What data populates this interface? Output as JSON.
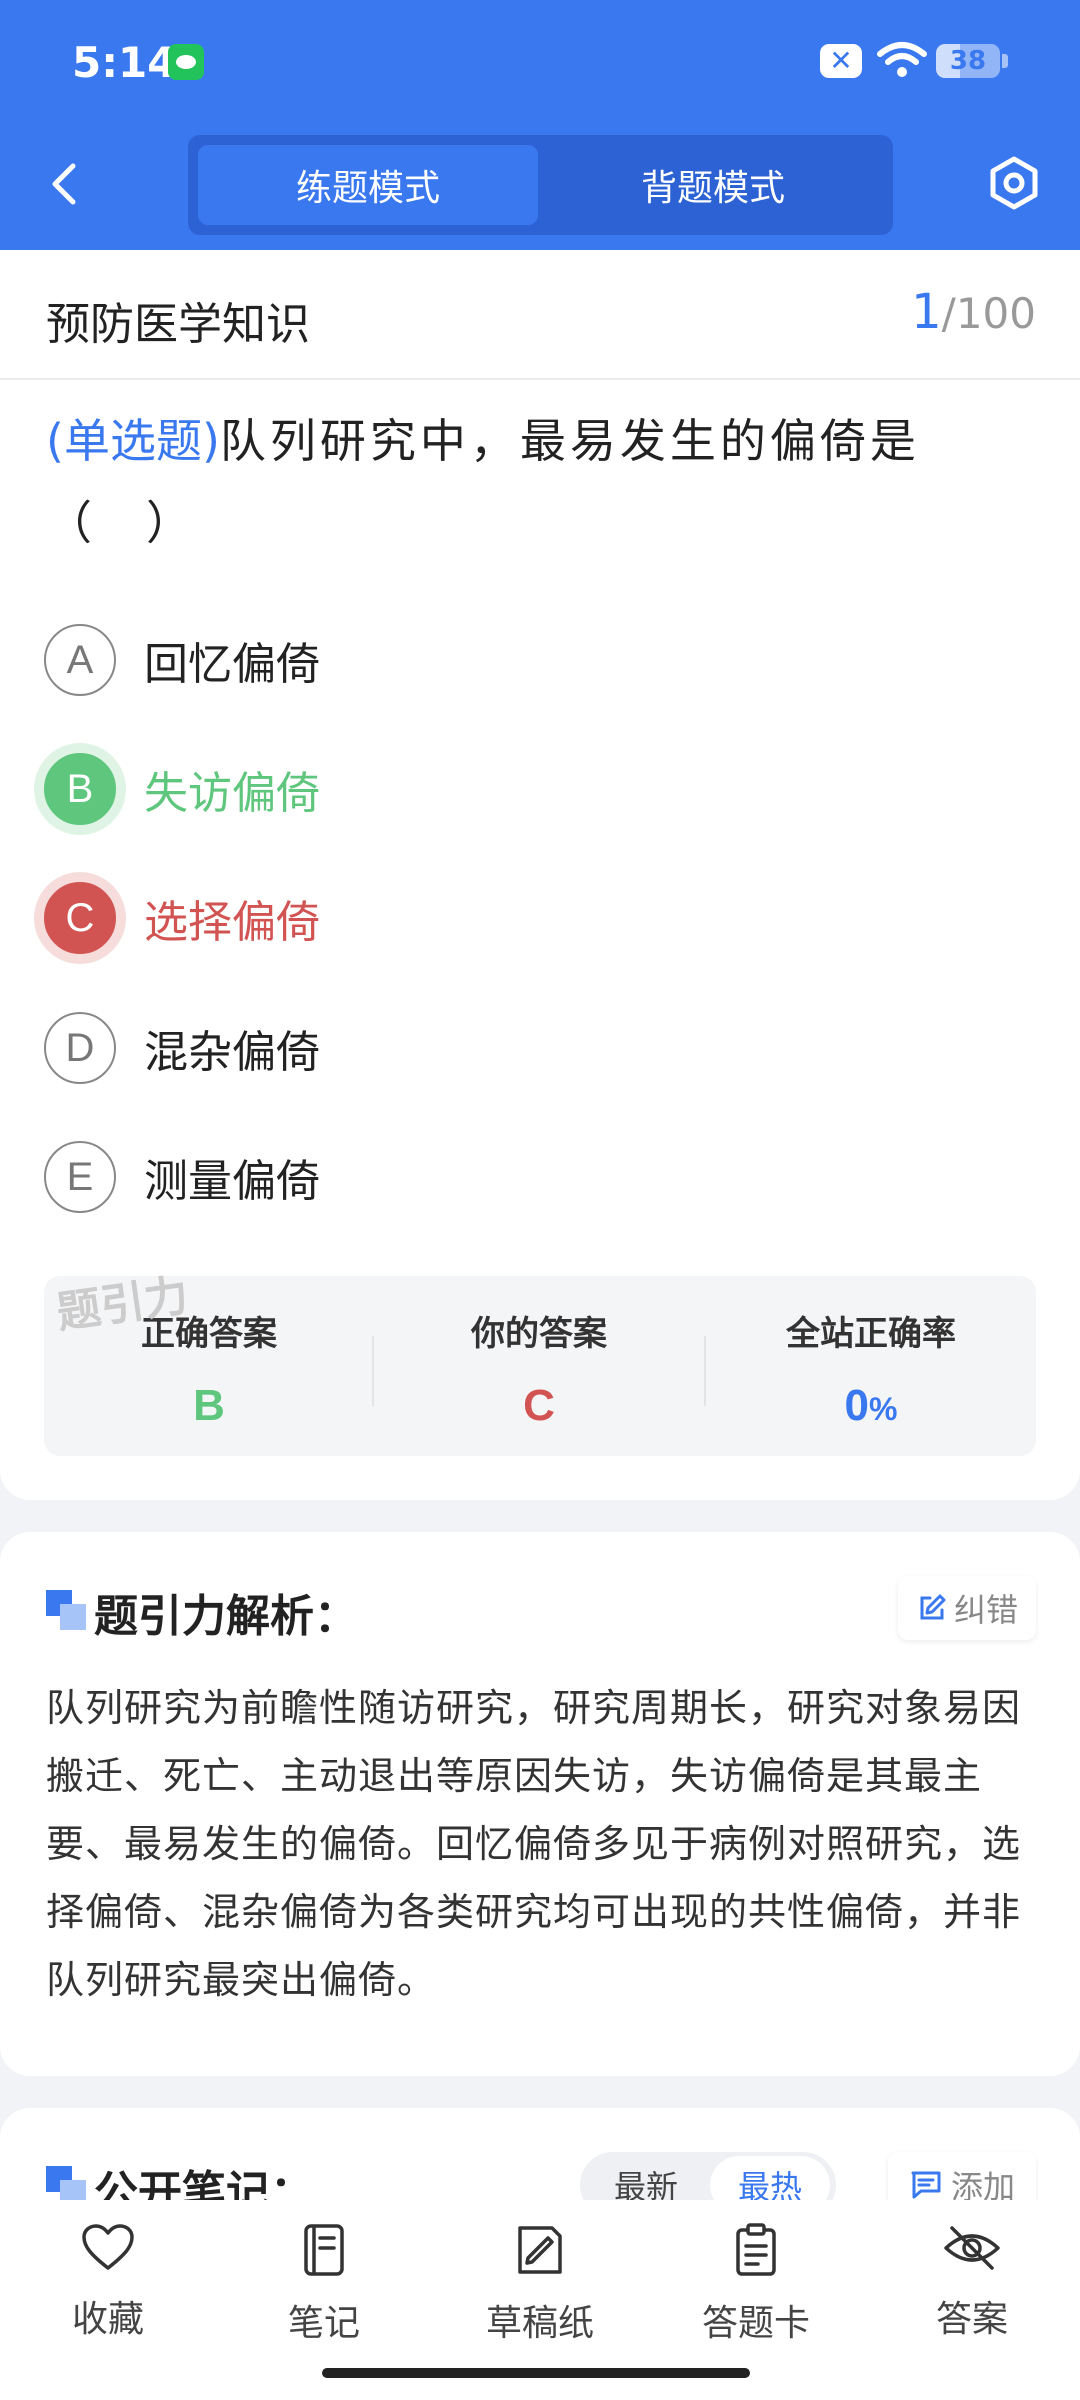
{
  "status_bar": {
    "time": "5:14",
    "battery": "38",
    "battery_level": 0.38
  },
  "header": {
    "back_icon": "chevron-left-icon",
    "tabs": [
      {
        "label": "练题模式",
        "active": true
      },
      {
        "label": "背题模式",
        "active": false
      }
    ],
    "settings_icon": "hexagon-settings-icon"
  },
  "question_header": {
    "subject": "预防医学知识",
    "current": "1",
    "total": "/100"
  },
  "question": {
    "type": "(单选题)",
    "text": "队列研究中，最易发生的偏倚是（　）"
  },
  "options": [
    {
      "letter": "A",
      "text": "回忆偏倚",
      "state": "normal"
    },
    {
      "letter": "B",
      "text": "失访偏倚",
      "state": "correct"
    },
    {
      "letter": "C",
      "text": "选择偏倚",
      "state": "wrong"
    },
    {
      "letter": "D",
      "text": "混杂偏倚",
      "state": "normal"
    },
    {
      "letter": "E",
      "text": "测量偏倚",
      "state": "normal"
    }
  ],
  "watermark": "题引力",
  "answer_summary": {
    "correct_label": "正确答案",
    "correct_value": "B",
    "yours_label": "你的答案",
    "yours_value": "C",
    "rate_label": "全站正确率",
    "rate_value": "0",
    "rate_unit": "%"
  },
  "analysis": {
    "title": "题引力解析：",
    "report_label": "纠错",
    "text": "队列研究为前瞻性随访研究，研究周期长，研究对象易因搬迁、死亡、主动退出等原因失访，失访偏倚是其最主要、最易发生的偏倚。回忆偏倚多见于病例对照研究，选择偏倚、混杂偏倚为各类研究均可出现的共性偏倚，并非队列研究最突出偏倚。"
  },
  "notes": {
    "title": "公开笔记：",
    "sort_options": [
      "最新",
      "最热"
    ],
    "sort_active": "最热",
    "add_label": "添加"
  },
  "bottom_nav": [
    {
      "label": "收藏",
      "icon": "heart-icon"
    },
    {
      "label": "笔记",
      "icon": "notebook-icon"
    },
    {
      "label": "草稿纸",
      "icon": "draft-paper-icon"
    },
    {
      "label": "答题卡",
      "icon": "answer-sheet-icon"
    },
    {
      "label": "答案",
      "icon": "eye-off-icon"
    }
  ],
  "colors": {
    "primary": "#3a78f0",
    "correct": "#5fc67d",
    "wrong": "#d25452"
  }
}
